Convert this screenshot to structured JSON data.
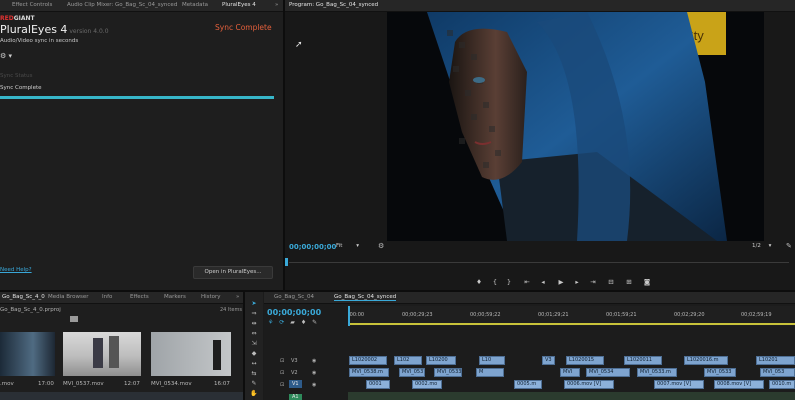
{
  "top_tabs": {
    "effect_controls": "Effect Controls",
    "audio_clip_mixer": "Audio Clip Mixer: Go_Bag_Sc_04_synced",
    "metadata": "Metadata",
    "plural_eyes": "PluralEyes 4",
    "more": "»",
    "program": "Program: Go_Bag_Sc_04_synced"
  },
  "plural_eyes": {
    "brand_red": "RED",
    "brand_rest": "GIANT",
    "title": "PluralEyes 4",
    "version": "version 4.0.0",
    "subtitle": "Audio/Video sync in seconds",
    "header_status": "Sync Complete",
    "sync_status_label": "Sync Status",
    "sync_status_value": "Sync Complete",
    "progress": 1.0,
    "need_help": "Need Help?",
    "open_button": "Open in PluralEyes..."
  },
  "program_monitor": {
    "timecode": "00;00;00;00",
    "fit": "Fit",
    "resolution": "1/2"
  },
  "project_panel": {
    "tabs": [
      "Go_Bag_Sc_4_0",
      "Media Browser",
      "Info",
      "Effects",
      "Markers",
      "History"
    ],
    "more": "»",
    "file": "Go_Bag_Sc_4_0.prproj",
    "items_count": "24 Items",
    "thumbnails": [
      {
        "name": ".mov",
        "duration": "17:00"
      },
      {
        "name": "MVI_0537.mov",
        "duration": "12:07"
      },
      {
        "name": "MVI_0534.mov",
        "duration": "16:07"
      }
    ]
  },
  "timeline": {
    "tabs": [
      "Go_Bag_Sc_04",
      "Go_Bag_Sc_04_synced"
    ],
    "timecode": "00;00;00;00",
    "ruler": [
      ":00:00",
      "00;00;29;23",
      "00;00;59;22",
      "00;01;29;21",
      "00;01;59;21",
      "00;02;29;20",
      "00;02;59;19"
    ],
    "tracks": [
      "V3",
      "V2",
      "V1",
      "A1"
    ],
    "v3_clips": [
      "L1020002",
      "L102",
      "L10200",
      "L10",
      "V3",
      "L1020015",
      "L1020011",
      "L1020016.m",
      "L10201"
    ],
    "v2_clips": [
      "MVI_0538.m",
      "MVI_0537",
      "MVI_0533",
      "M",
      "MVI",
      "MVI_0534",
      "MVI_0533.m",
      "MVI_0533",
      "MVI_053"
    ],
    "v1_clips": [
      "0001",
      "0002.mo",
      "0005.m",
      "0006.mov [V]",
      "0007.mov [V]",
      "0008.mov [V]",
      "0010.m"
    ]
  },
  "colors": {
    "accent_blue": "#3aa9d8",
    "sync_orange": "#e4603c",
    "progress_cyan": "#37b6c9",
    "clip_blue": "#7ea4cf"
  }
}
